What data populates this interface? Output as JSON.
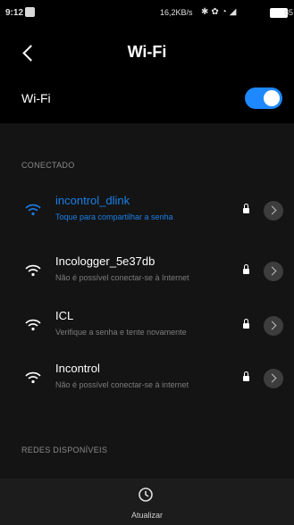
{
  "status_bar": {
    "time": "9:12",
    "network_speed": "16,2KB/s",
    "battery": "85"
  },
  "header": {
    "title": "Wi-Fi"
  },
  "wifi_toggle": {
    "label": "Wi-Fi",
    "enabled": true
  },
  "sections": {
    "connected_label": "CONECTADO",
    "available_label": "REDES DISPONÍVEIS"
  },
  "networks": [
    {
      "name": "incontrol_dlink",
      "status": "Toque para compartilhar a senha",
      "connected": true,
      "locked": true
    },
    {
      "name": "Incologger_5e37db",
      "status": "Não é possível conectar-se à Internet",
      "connected": false,
      "locked": true
    },
    {
      "name": "ICL",
      "status": "Verifique a senha e tente novamente",
      "connected": false,
      "locked": true
    },
    {
      "name": "Incontrol",
      "status": "Não é possível conectar-se à internet",
      "connected": false,
      "locked": true
    }
  ],
  "bottom_bar": {
    "refresh_label": "Atualizar"
  },
  "colors": {
    "accent": "#1e88ff",
    "connected_text": "#1a7fe8",
    "background": "#000000",
    "panel": "#141414"
  }
}
